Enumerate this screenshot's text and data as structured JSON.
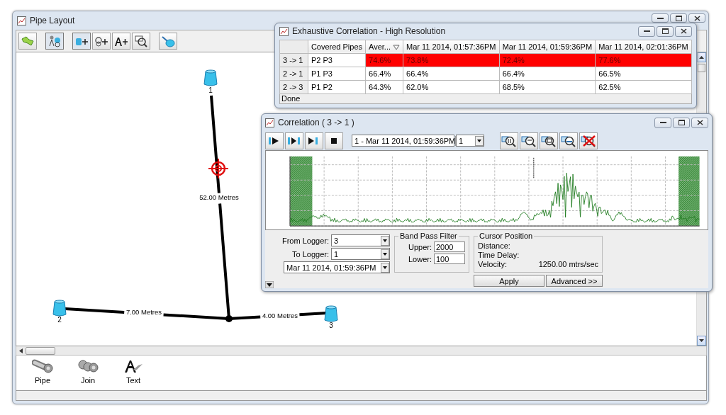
{
  "main_window": {
    "title": "Pipe Layout"
  },
  "diagram": {
    "loggers": [
      {
        "label": "1"
      },
      {
        "label": "2"
      },
      {
        "label": "3"
      }
    ],
    "pipes": [
      {
        "label": "52.00 Metres"
      },
      {
        "label": "7.00 Metres"
      },
      {
        "label": "4.00 Metres"
      }
    ]
  },
  "palette": [
    {
      "label": "Pipe"
    },
    {
      "label": "Join"
    },
    {
      "label": "Text"
    }
  ],
  "exhaustive": {
    "title": "Exhaustive Correlation - High Resolution",
    "columns": [
      {
        "label": "Covered Pipes",
        "sorted": false
      },
      {
        "label": "Aver...",
        "sorted": true
      },
      {
        "label": "Mar 11 2014, 01:57:36PM",
        "sorted": false
      },
      {
        "label": "Mar 11 2014, 01:59:36PM",
        "sorted": false
      },
      {
        "label": "Mar 11 2014, 02:01:36PM",
        "sorted": false
      }
    ],
    "rows": [
      {
        "pair": "3 -> 1",
        "pipes": "P2 P3",
        "values": [
          "74.6%",
          "73.8%",
          "72.4%",
          "77.6%"
        ],
        "highlighted": true
      },
      {
        "pair": "2 -> 1",
        "pipes": "P1 P3",
        "values": [
          "66.4%",
          "66.4%",
          "66.4%",
          "66.5%"
        ],
        "highlighted": false
      },
      {
        "pair": "2 -> 3",
        "pipes": "P1 P2",
        "values": [
          "64.3%",
          "62.0%",
          "68.5%",
          "62.5%"
        ],
        "highlighted": false
      }
    ],
    "status": "Done"
  },
  "correlation": {
    "title": "Correlation ( 3 -> 1 )",
    "result_select": "1 - Mar 11 2014, 01:59:36PM",
    "count_select": "1",
    "from_logger": {
      "label": "From Logger:",
      "value": "3"
    },
    "to_logger": {
      "label": "To Logger:",
      "value": "1"
    },
    "date_select": "Mar 11 2014, 01:59:36PM",
    "band_pass": {
      "title": "Band Pass Filter",
      "fields": [
        {
          "label": "Upper:",
          "value": "2000"
        },
        {
          "label": "Lower:",
          "value": "100"
        }
      ]
    },
    "cursor": {
      "title": "Cursor Position",
      "rows": [
        {
          "label": "Distance:"
        },
        {
          "label": "Time Delay:"
        },
        {
          "label": "Velocity:",
          "value": "1250.00 mtrs/sec"
        }
      ]
    },
    "buttons": [
      "Apply",
      "Advanced >>"
    ]
  }
}
